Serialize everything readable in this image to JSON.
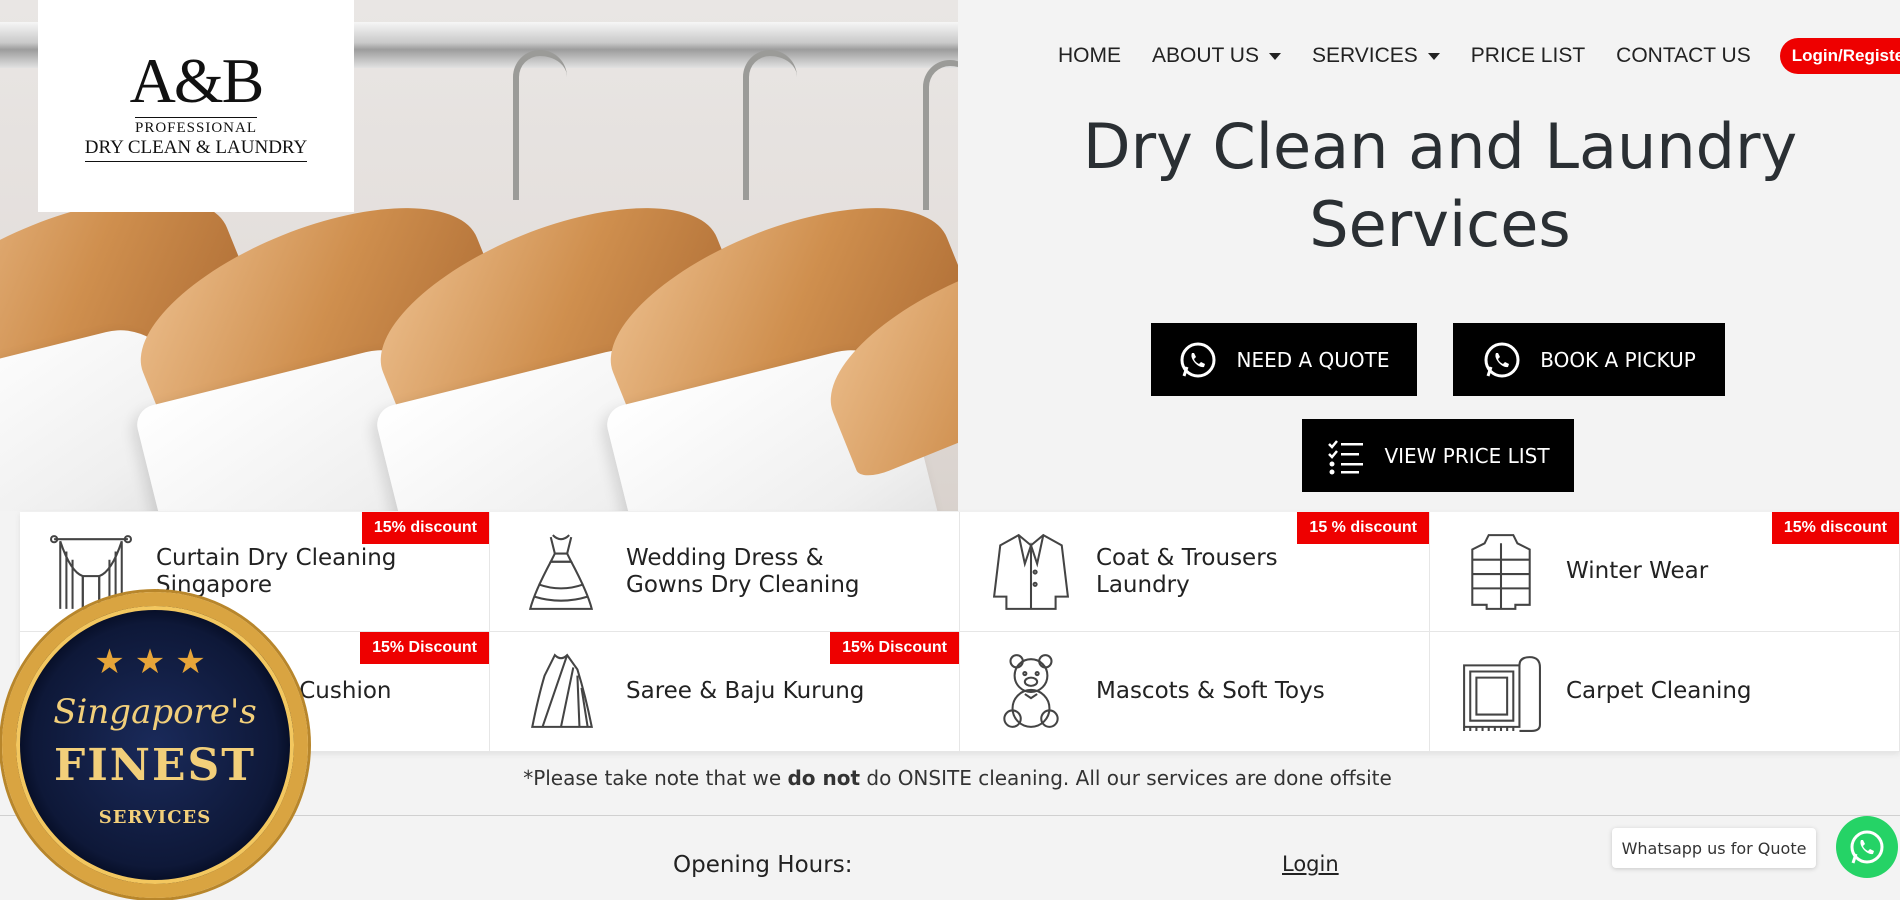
{
  "brand": {
    "logo_mark": "A&B",
    "logo_line1": "PROFESSIONAL",
    "logo_line2": "DRY CLEAN & LAUNDRY"
  },
  "nav": {
    "items": [
      {
        "label": "HOME",
        "dropdown": false
      },
      {
        "label": "ABOUT US",
        "dropdown": true
      },
      {
        "label": "SERVICES",
        "dropdown": true
      },
      {
        "label": "PRICE LIST",
        "dropdown": false
      },
      {
        "label": "CONTACT US",
        "dropdown": false
      }
    ],
    "login_label": "Login/Register"
  },
  "hero": {
    "title_line1": "Dry Clean and Laundry",
    "title_line2": "Services",
    "cta_quote": "NEED A QUOTE",
    "cta_pickup": "BOOK A PICKUP",
    "cta_price": "VIEW PRICE LIST"
  },
  "services": [
    {
      "label_line1": "Curtain Dry Cleaning",
      "label_line2": "Singapore",
      "badge": "15% discount",
      "icon": "curtain-icon"
    },
    {
      "label_line1": "Wedding Dress &",
      "label_line2": "Gowns Dry Cleaning",
      "badge": "",
      "icon": "dress-icon"
    },
    {
      "label_line1": "Coat & Trousers",
      "label_line2": "Laundry",
      "badge": "15 % discount",
      "icon": "coat-icon"
    },
    {
      "label_line1": "Winter Wear",
      "label_line2": "",
      "badge": "15% discount",
      "icon": "jacket-icon"
    },
    {
      "label_line1": "& Cushion",
      "label_line2": "",
      "badge": "15% Discount",
      "icon": "sofa-icon"
    },
    {
      "label_line1": "Saree & Baju Kurung",
      "label_line2": "",
      "badge": "15% Discount",
      "icon": "saree-icon"
    },
    {
      "label_line1": "Mascots & Soft Toys",
      "label_line2": "",
      "badge": "",
      "icon": "teddy-bear-icon"
    },
    {
      "label_line1": "Carpet Cleaning",
      "label_line2": "",
      "badge": "",
      "icon": "carpet-icon"
    }
  ],
  "note": {
    "prefix": "*Please take note that we ",
    "bold": "do not",
    "suffix": " do ONSITE cleaning. All our services are done offsite"
  },
  "footer": {
    "hours_heading": "Opening Hours:",
    "login_link": "Login"
  },
  "whatsapp": {
    "tooltip": "Whatsapp us for Quote"
  },
  "seal": {
    "stars": "★★★",
    "script": "Singapore's",
    "finest": "FINEST",
    "services": "SERVICES"
  },
  "colors": {
    "accent_red": "#ee0000",
    "whatsapp_green": "#25d366",
    "cta_black": "#000000",
    "seal_gold": "#d9a441",
    "seal_navy": "#0e1838"
  }
}
